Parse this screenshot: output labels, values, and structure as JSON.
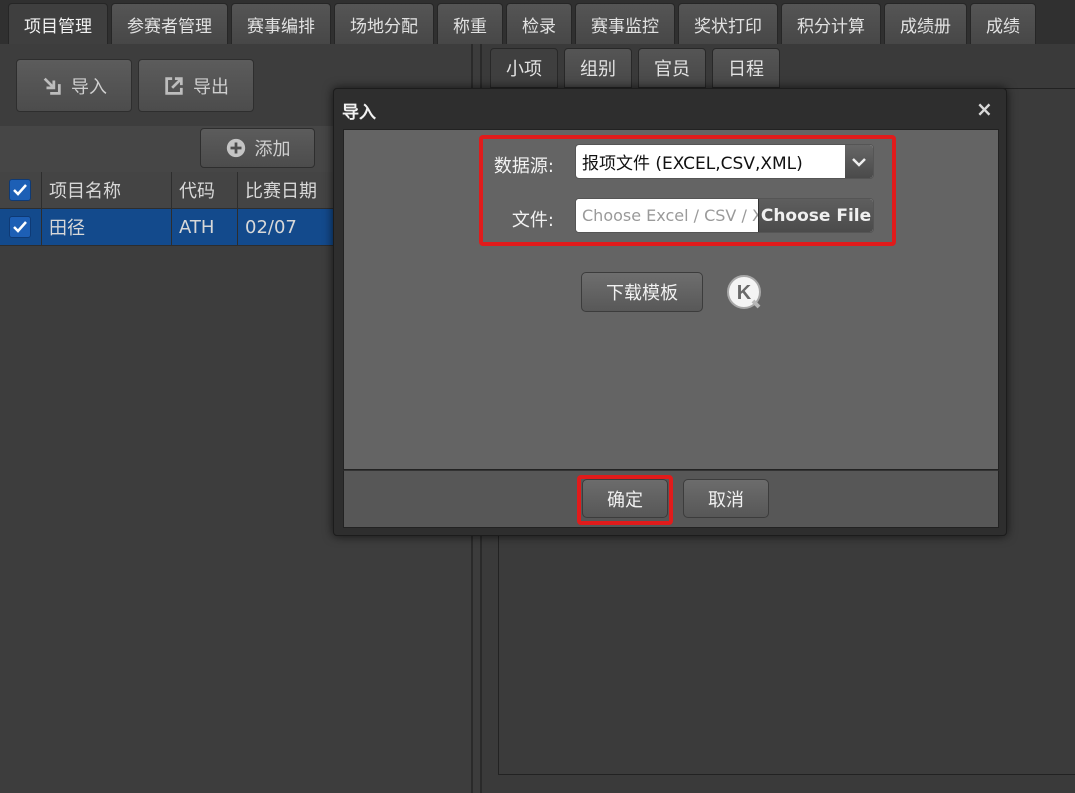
{
  "top_tabs": [
    "项目管理",
    "参赛者管理",
    "赛事编排",
    "场地分配",
    "称重",
    "检录",
    "赛事监控",
    "奖状打印",
    "积分计算",
    "成绩册",
    "成绩"
  ],
  "left_toolbar": {
    "import_label": "导入",
    "export_label": "导出",
    "add_label": "添加"
  },
  "table": {
    "headers": [
      "项目名称",
      "代码",
      "比赛日期"
    ],
    "rows": [
      {
        "name": "田径",
        "code": "ATH",
        "date": "02/07"
      }
    ]
  },
  "sub_tabs": [
    "小项",
    "组别",
    "官员",
    "日程"
  ],
  "dialog": {
    "title": "导入",
    "close_glyph": "×",
    "source_label": "数据源:",
    "source_value": "报项文件 (EXCEL,CSV,XML)",
    "file_label": "文件:",
    "file_placeholder": "Choose Excel / CSV / XML",
    "file_button": "Choose File",
    "download_template": "下载模板",
    "k_icon_text": "K",
    "confirm_label": "确定",
    "cancel_label": "取消"
  },
  "colors": {
    "highlight": "#e01b1b",
    "selected_row": "#134a8c",
    "checkbox": "#1d5fb5"
  }
}
